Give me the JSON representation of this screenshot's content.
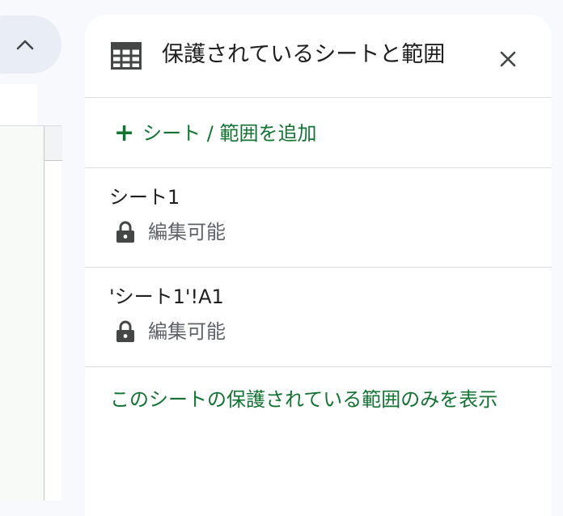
{
  "panel": {
    "title": "保護されているシートと範囲",
    "add_label": "シート / 範囲を追加",
    "items": [
      {
        "name": "シート1",
        "desc": "編集可能"
      },
      {
        "name": "'シート1'!A1",
        "desc": "編集可能"
      }
    ],
    "show_only_label": "このシートの保護されている範囲のみを表示"
  },
  "colors": {
    "accent_green": "#137333",
    "text_primary": "#1f1f1f",
    "text_secondary": "#5f6368",
    "divider": "#dadce0"
  },
  "icons": {
    "header": "table-grid-icon",
    "close": "close-icon",
    "add": "plus-icon",
    "item": "lock-icon",
    "collapse": "chevron-up-icon"
  }
}
